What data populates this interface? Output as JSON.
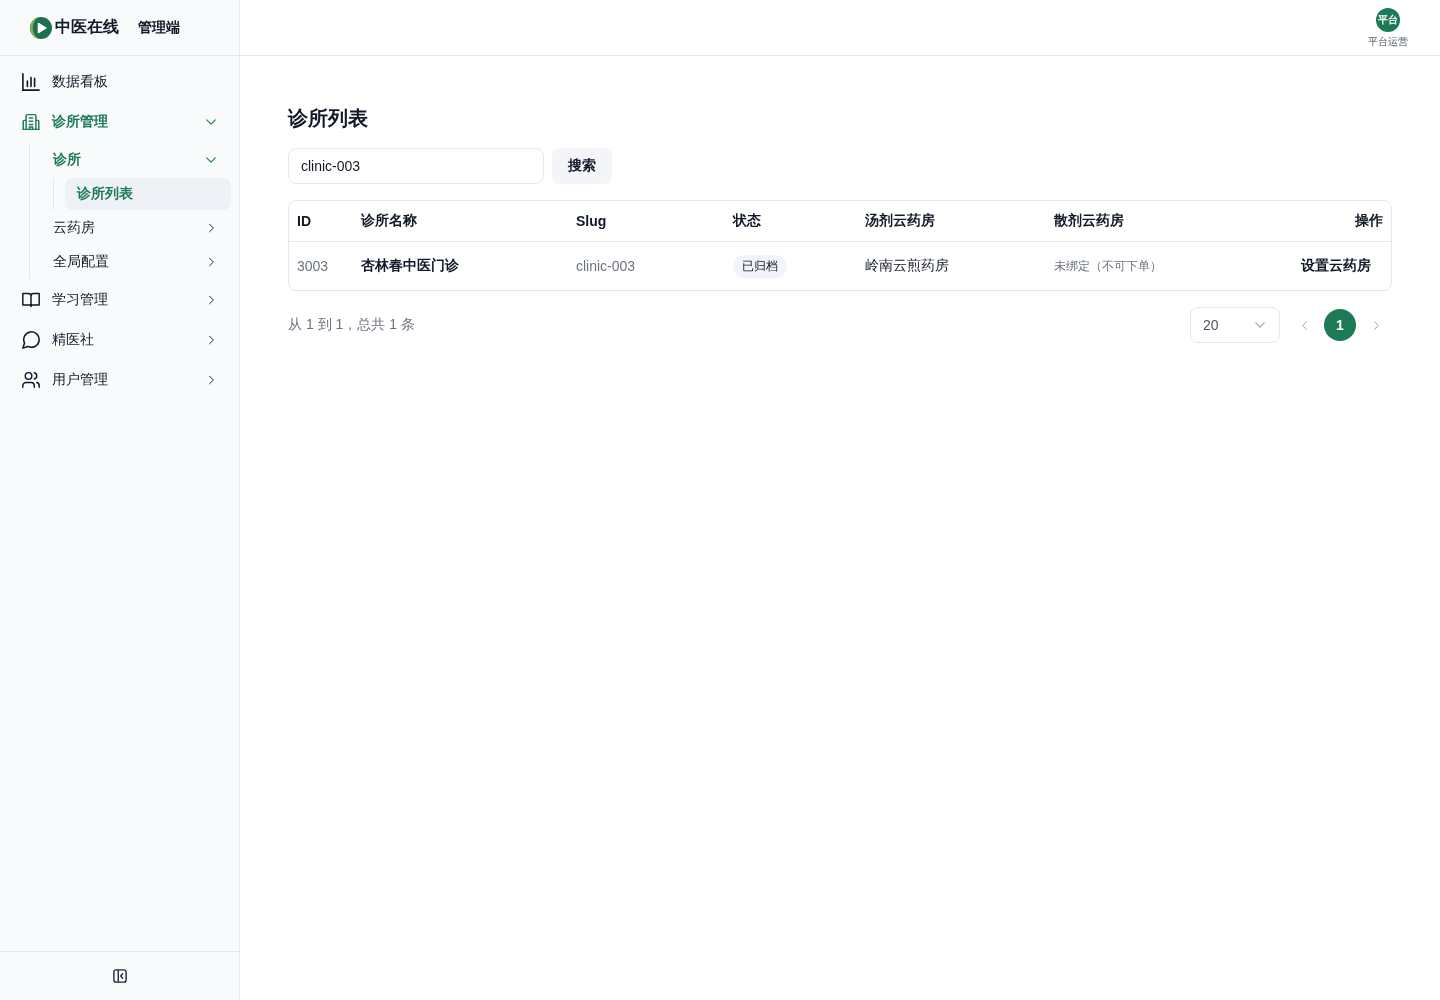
{
  "brand": {
    "name": "中医在线",
    "subtitle": "管理端"
  },
  "nav": [
    {
      "label": "数据看板",
      "selected": false
    },
    {
      "label": "诊所管理",
      "selected": true,
      "expanded": true,
      "children": [
        {
          "label": "诊所",
          "selected": true,
          "expanded": true,
          "children": [
            {
              "label": "诊所列表",
              "selected": true
            }
          ]
        },
        {
          "label": "云药房",
          "selected": false,
          "expanded": false
        },
        {
          "label": "全局配置",
          "selected": false,
          "expanded": false
        }
      ]
    },
    {
      "label": "学习管理",
      "selected": false,
      "expanded": false
    },
    {
      "label": "精医社",
      "selected": false,
      "expanded": false
    },
    {
      "label": "用户管理",
      "selected": false,
      "expanded": false
    }
  ],
  "user": {
    "avatar_text": "平台",
    "role": "平台运营"
  },
  "page": {
    "title": "诊所列表"
  },
  "search": {
    "value": "clinic-003",
    "button": "搜索"
  },
  "table": {
    "columns": [
      {
        "label": "ID",
        "kind": "muted"
      },
      {
        "label": "诊所名称",
        "kind": "strong"
      },
      {
        "label": "Slug",
        "kind": "muted"
      },
      {
        "label": "状态",
        "kind": "badge"
      },
      {
        "label": "汤剂云药房",
        "kind": "plain"
      },
      {
        "label": "散剂云药房",
        "kind": "note"
      },
      {
        "label": "操作",
        "kind": "action"
      }
    ],
    "rows": [
      {
        "cells": [
          "3003",
          "杏林春中医门诊",
          "clinic-003",
          "已归档",
          "岭南云煎药房",
          "未绑定（不可下单）",
          "设置云药房"
        ]
      }
    ]
  },
  "pagination": {
    "summary": "从 1 到 1，总共 1 条",
    "page_size": "20",
    "pages": [
      {
        "label": "1",
        "selected": true
      }
    ]
  }
}
